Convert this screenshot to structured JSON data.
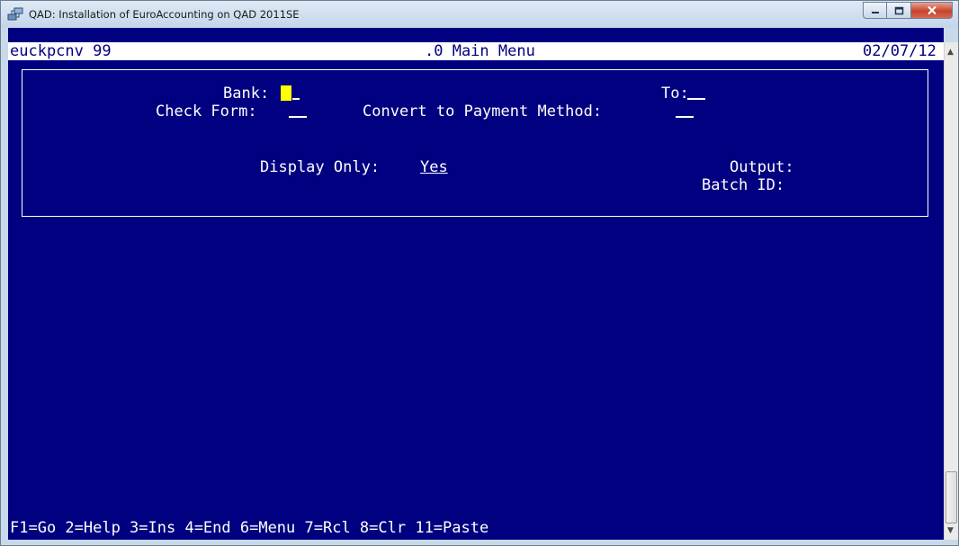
{
  "window": {
    "title": "QAD: Installation of EuroAccounting on QAD 2011SE",
    "app_icon": "qad-network-icon",
    "controls": [
      "minimize-icon",
      "maximize-icon",
      "close-icon"
    ]
  },
  "header": {
    "program": "euckpcnv 99",
    "menu": ".0 Main Menu",
    "date": "02/07/12"
  },
  "form": {
    "bank_label": "Bank:",
    "to_label": "To:",
    "check_form_label": "Check Form:",
    "convert_label": "Convert to Payment Method:",
    "display_only_label": "Display Only:",
    "display_only_value": "Yes",
    "output_label": "Output:",
    "batch_id_label": "Batch ID:"
  },
  "footer": {
    "function_keys": "F1=Go 2=Help 3=Ins 4=End 6=Menu 7=Rcl 8=Clr 11=Paste"
  },
  "colors": {
    "background": "#000080",
    "text": "#ffffff",
    "cursor": "#ffff00"
  }
}
